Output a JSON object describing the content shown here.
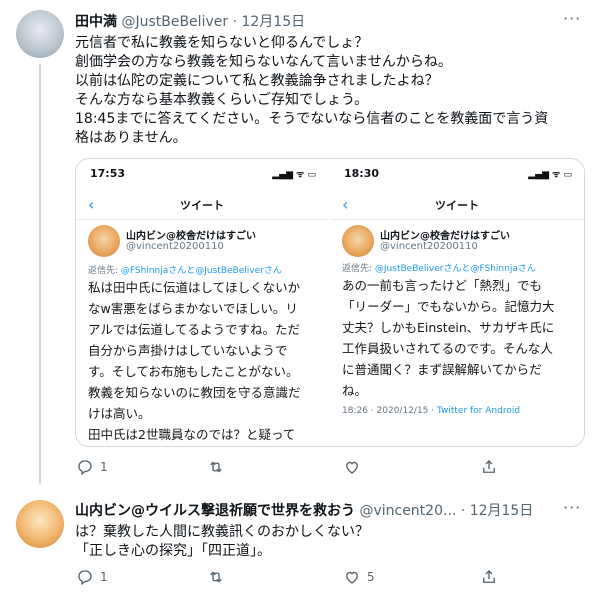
{
  "tweet1": {
    "name": "田中満",
    "handle": "@JustBeBeliver",
    "separator": "·",
    "date": "12月15日",
    "more": "···",
    "text": "元信者で私に教義を知らないと仰るんでしょ？\n創価学会の方なら教義を知らないなんて言いませんからね。\n以前は仏陀の定義について私と教義論争されましたよね？\nそんな方なら基本教義くらいご存知でしょう。\n18:45までに答えてください。そうでないなら信者のことを教義面で言う資\n格はありません。",
    "shots": [
      {
        "status_time": "17:53",
        "status_icons": "▂▄▆ ᯤ ▭",
        "back": "‹",
        "title": "ツイート",
        "user_name": "山内ビン@校舎だけはすごい",
        "user_handle": "@vincent20200110",
        "reply_prefix": "返信先: ",
        "reply_users": "@FShinnjaさんと@JustBeBeliverさん",
        "body": "私は田中氏に伝道はしてほしくないか\nなw害悪をばらまかないでほしい。リ\nアルでは伝道してるようですね。ただ\n自分から声掛けはしていないようで\nす。そしてお布施もしたことがない。\n教義を知らないのに教団を守る意識だ\nけは高い。\n田中氏は2世職員なのでは？と疑って"
      },
      {
        "status_time": "18:30",
        "status_icons": "▂▄▆ ᯤ ▭",
        "back": "‹",
        "title": "ツイート",
        "user_name": "山内ビン@校舎だけはすごい",
        "user_handle": "@vincent20200110",
        "reply_prefix": "返信先: ",
        "reply_users": "@JustBeBeliverさんと@FShinnjaさん",
        "body": "あの一前も言ったけど「熱烈」でも\n「リーダー」でもないから。記憶力大\n丈夫？しかもEinstein、サカザキ氏に\n工作員扱いされてるのです。そんな人\nに普通聞く？まず誤解解いてからだ\nね。",
        "meta_time": "18:26 · 2020/12/15 · ",
        "meta_client": "Twitter for Android"
      }
    ],
    "actions": {
      "reply_count": "1",
      "retweet_count": "",
      "like_count": ""
    }
  },
  "tweet2": {
    "name": "山内ビン@ウイルス撃退祈願で世界を救おう",
    "handle": "@vincent20...",
    "separator": "·",
    "date": "12月15日",
    "more": "···",
    "text": "は？棄教した人間に教義訊くのおかしくない？\n「正しき心の探究」「四正道」。",
    "actions": {
      "reply_count": "1",
      "retweet_count": "",
      "like_count": "5"
    }
  }
}
